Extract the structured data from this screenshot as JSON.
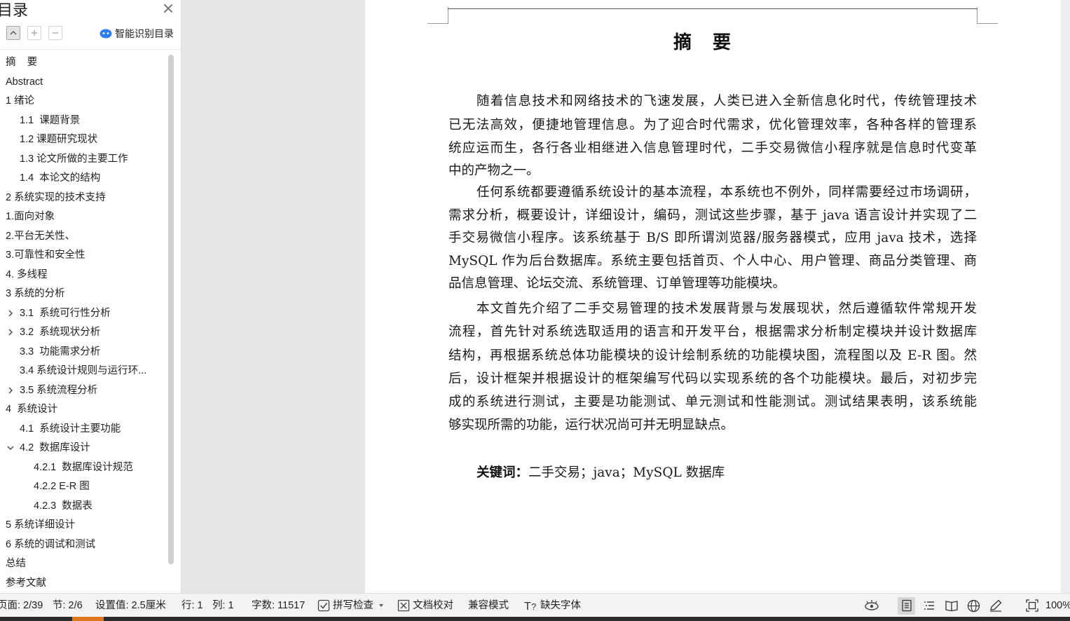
{
  "toc": {
    "title": "目录",
    "smart_toc_label": "智能识别目录",
    "items": [
      {
        "label": "摘    要",
        "expand": "none"
      },
      {
        "label": "Abstract",
        "expand": "none"
      },
      {
        "label": "1 绪论",
        "expand": "none"
      },
      {
        "label": "1.1  课题背景",
        "expand": "none"
      },
      {
        "label": "1.2 课题研究现状",
        "expand": "none"
      },
      {
        "label": "1.3 论文所做的主要工作",
        "expand": "none"
      },
      {
        "label": "1.4  本论文的结构",
        "expand": "none"
      },
      {
        "label": "2 系统实现的技术支持",
        "expand": "none"
      },
      {
        "label": "1.面向对象",
        "expand": "none"
      },
      {
        "label": "2.平台无关性、",
        "expand": "none"
      },
      {
        "label": "3.可靠性和安全性",
        "expand": "none"
      },
      {
        "label": "4. 多线程",
        "expand": "none"
      },
      {
        "label": "3 系统的分析",
        "expand": "none"
      },
      {
        "label": "3.1  系统可行性分析",
        "expand": "collapsed"
      },
      {
        "label": "3.2  系统现状分析",
        "expand": "collapsed"
      },
      {
        "label": "3.3  功能需求分析",
        "expand": "none"
      },
      {
        "label": "3.4 系统设计规则与运行环...",
        "expand": "none"
      },
      {
        "label": "3.5 系统流程分析",
        "expand": "collapsed"
      },
      {
        "label": "4  系统设计",
        "expand": "none"
      },
      {
        "label": "4.1  系统设计主要功能",
        "expand": "none"
      },
      {
        "label": "4.2  数据库设计",
        "expand": "expanded"
      },
      {
        "label": "4.2.1  数据库设计规范",
        "expand": "none"
      },
      {
        "label": "4.2.2 E-R 图",
        "expand": "none"
      },
      {
        "label": "4.2.3  数据表",
        "expand": "none"
      },
      {
        "label": "5 系统详细设计",
        "expand": "none"
      },
      {
        "label": "6 系统的调试和测试",
        "expand": "none"
      },
      {
        "label": "总结",
        "expand": "none"
      },
      {
        "label": "参考文献",
        "expand": "none"
      }
    ]
  },
  "document": {
    "title": "摘要",
    "lines": [
      "随着信息技术和网络技术的飞速发展，人类已进入全新信息化时代，传统管理技术",
      "已无法高效，便捷地管理信息。为了迎合时代需求，优化管理效率，各种各样的管理系",
      "统应运而生，各行各业相继进入信息管理时代，二手交易微信小程序就是信息时代变革",
      "中的产物之一。",
      "任何系统都要遵循系统设计的基本流程，本系统也不例外，同样需要经过市场调研，",
      "需求分析，概要设计，详细设计，编码，测试这些步骤，基于 java 语言设计并实现了二",
      "手交易微信小程序。该系统基于 B/S 即所谓浏览器/服务器模式，应用 java 技术，选择",
      "MySQL 作为后台数据库。系统主要包括首页、个人中心、用户管理、商品分类管理、商",
      "品信息管理、论坛交流、系统管理、订单管理等功能模块。",
      "本文首先介绍了二手交易管理的技术发展背景与发展现状，然后遵循软件常规开发",
      "流程，首先针对系统选取适用的语言和开发平台，根据需求分析制定模块并设计数据库",
      "结构，再根据系统总体功能模块的设计绘制系统的功能模块图，流程图以及 E-R 图。然",
      "后，设计框架并根据设计的框架编写代码以实现系统的各个功能模块。最后，对初步完",
      "成的系统进行测试，主要是功能测试、单元测试和性能测试。测试结果表明，该系统能",
      "够实现所需的功能，运行状况尚可并无明显缺点。"
    ],
    "keywords_label": "关键词：",
    "keywords_text": "二手交易；java；MySQL 数据库"
  },
  "status_bar": {
    "page": "页面: 2/39",
    "section": "节: 2/6",
    "setting": "设置值: 2.5厘米",
    "row": "行: 1",
    "col": "列: 1",
    "word_count": "字数: 11517",
    "spell_check": "拼写检查",
    "doc_proof": "文档校对",
    "compat_mode": "兼容模式",
    "missing_fonts": "缺失字体",
    "zoom": "100%"
  },
  "colors": {
    "panel_bg": "#ffffff",
    "workspace_bg": "#e5e6e8",
    "statusbar_bg": "#f3f3f3",
    "smart_toc_icon": "#2f7df6",
    "taskbar_accent": "#e0771f"
  }
}
